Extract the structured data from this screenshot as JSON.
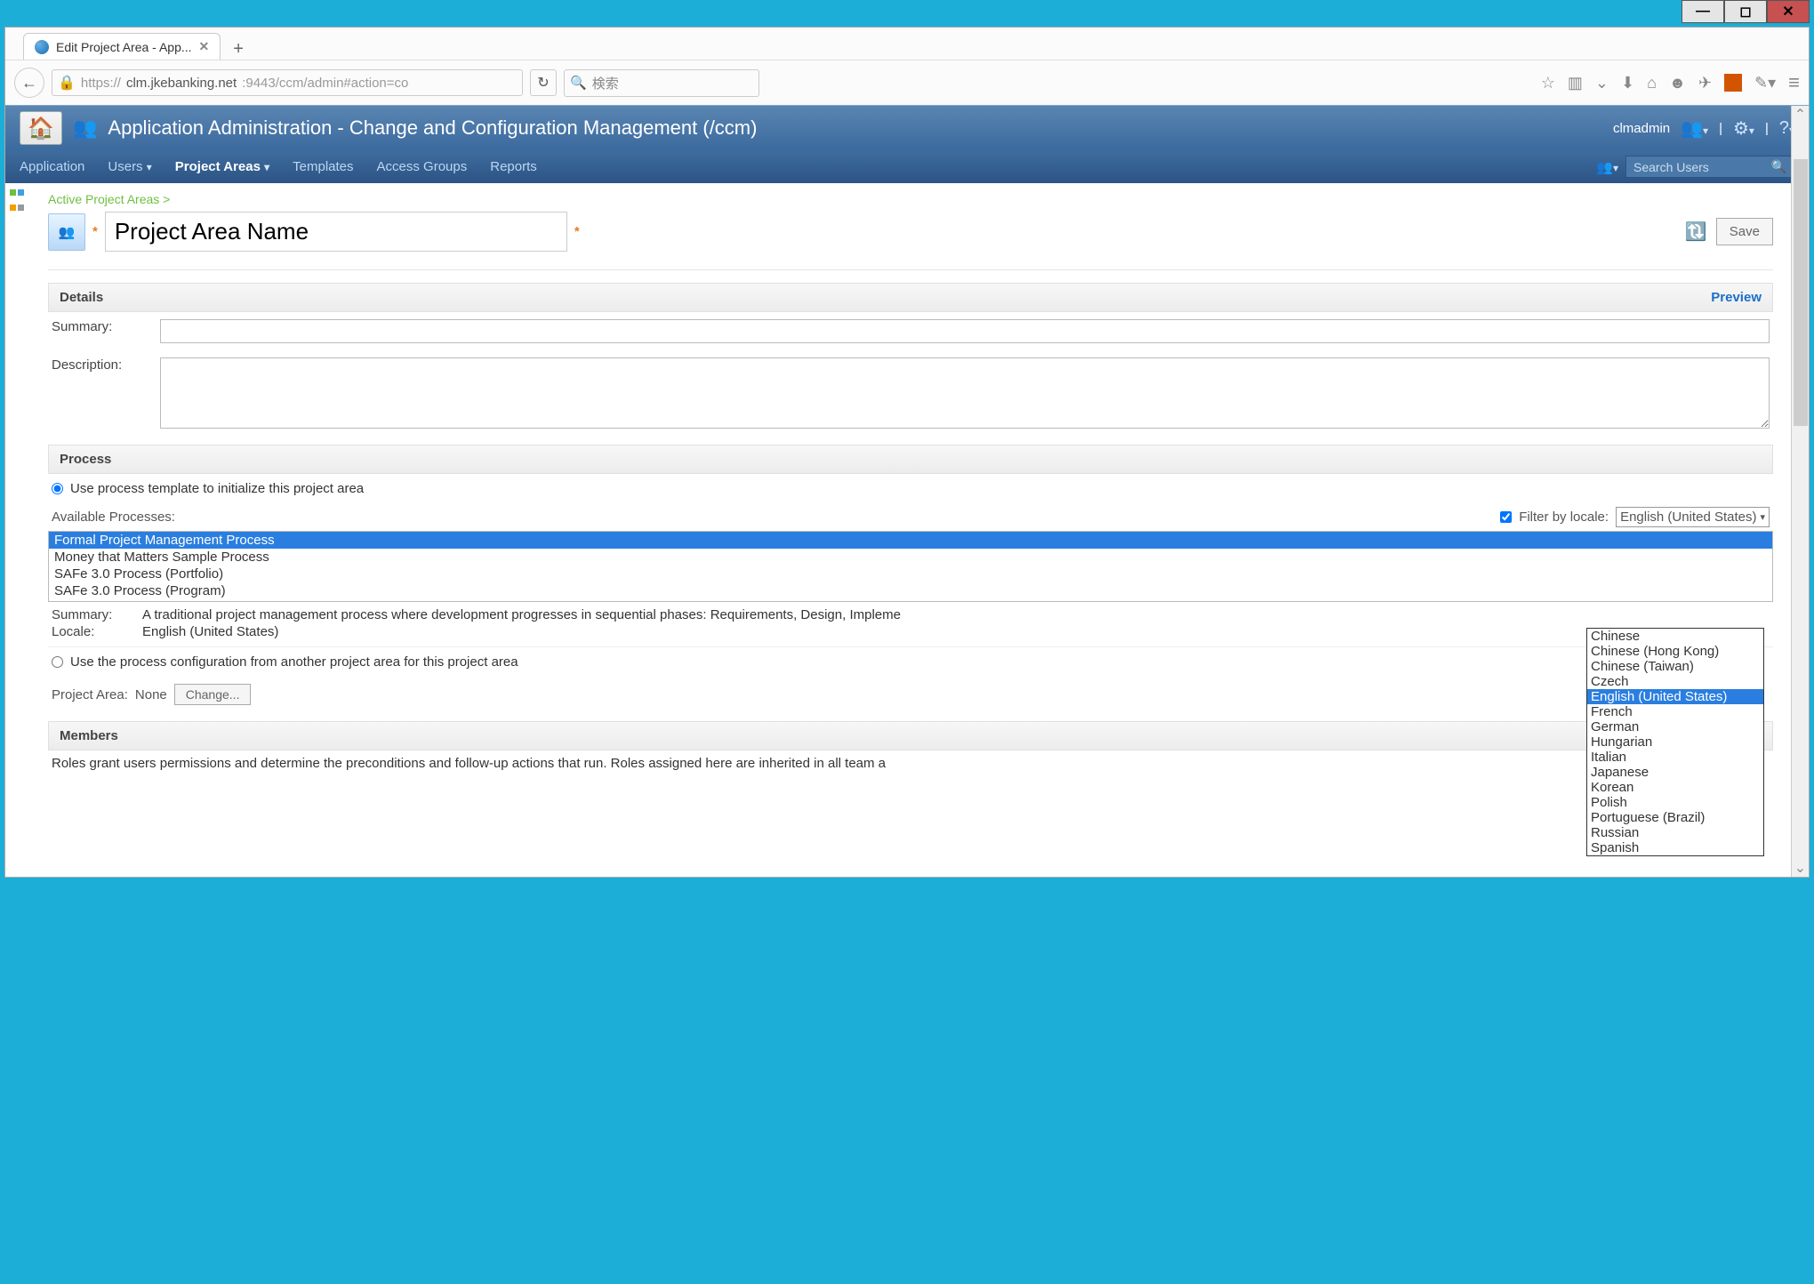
{
  "window": {
    "tab_title": "Edit Project Area - App...",
    "url_prefix": "https://",
    "url_host": "clm.jkebanking.net",
    "url_port": ":9443/ccm/admin#action=co",
    "search_placeholder": "検索"
  },
  "header": {
    "title": "Application Administration - Change and Configuration Management (/ccm)",
    "user": "clmadmin"
  },
  "nav": {
    "items": [
      "Application",
      "Users",
      "Project Areas",
      "Templates",
      "Access Groups",
      "Reports"
    ],
    "active": "Project Areas",
    "search_placeholder": "Search Users"
  },
  "breadcrumb": "Active Project Areas >",
  "project_name": "Project Area Name",
  "save_button": "Save",
  "sections": {
    "details": {
      "title": "Details",
      "preview": "Preview",
      "summary_label": "Summary:",
      "description_label": "Description:"
    },
    "process": {
      "title": "Process",
      "radio1": "Use process template to initialize this project area",
      "radio2": "Use the process configuration from another project area for this project area",
      "available_label": "Available Processes:",
      "filter_label": "Filter by locale:",
      "filter_value": "English (United States)",
      "options": [
        "Formal Project Management Process",
        "Money that Matters Sample Process",
        "SAFe 3.0 Process (Portfolio)",
        "SAFe 3.0 Process (Program)"
      ],
      "selected_index": 0,
      "summary_label": "Summary:",
      "summary_value": "A traditional project management process where development progresses in sequential phases: Requirements, Design, Impleme",
      "locale_label": "Locale:",
      "locale_value": "English (United States)",
      "project_area_label": "Project Area:",
      "project_area_value": "None",
      "change_button": "Change..."
    },
    "members": {
      "title": "Members",
      "desc": "Roles grant users permissions and determine the preconditions and follow-up actions that run. Roles assigned here are inherited in all team a"
    }
  },
  "locale_dropdown": {
    "options": [
      "Chinese",
      "Chinese (Hong Kong)",
      "Chinese (Taiwan)",
      "Czech",
      "English (United States)",
      "French",
      "German",
      "Hungarian",
      "Italian",
      "Japanese",
      "Korean",
      "Polish",
      "Portuguese (Brazil)",
      "Russian",
      "Spanish"
    ],
    "selected": "English (United States)"
  }
}
